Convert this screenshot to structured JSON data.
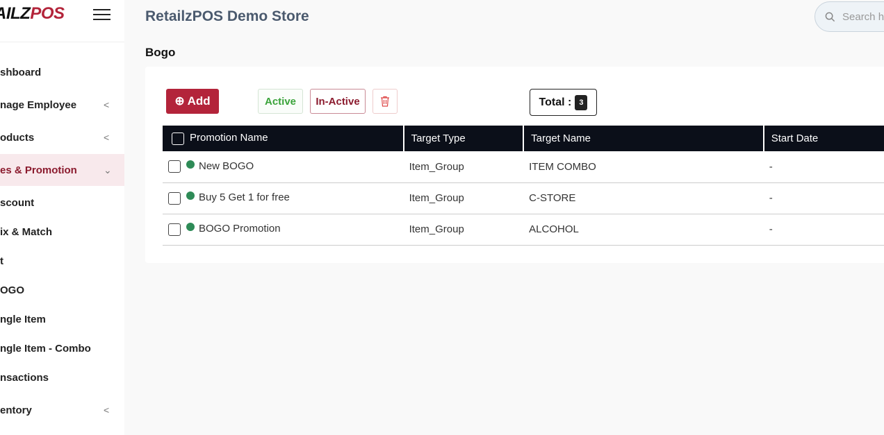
{
  "logo": {
    "part1": "AILZ",
    "part2": "POS"
  },
  "sidebar": {
    "items": [
      {
        "label": "shboard",
        "chevron": ""
      },
      {
        "label": "nage Employee",
        "chevron": "<"
      },
      {
        "label": "oducts",
        "chevron": "<"
      },
      {
        "label": "es & Promotion",
        "chevron": "⌄",
        "active": true
      },
      {
        "label": "scount"
      },
      {
        "label": "ix & Match"
      },
      {
        "label": "t"
      },
      {
        "label": "OGO"
      },
      {
        "label": "ngle Item"
      },
      {
        "label": "ngle Item - Combo"
      },
      {
        "label": "nsactions"
      },
      {
        "label": "entory",
        "chevron": "<"
      }
    ]
  },
  "header": {
    "title": "RetailzPOS Demo Store",
    "search_placeholder": "Search he"
  },
  "page": {
    "title": "Bogo"
  },
  "toolbar": {
    "add": "Add",
    "active": "Active",
    "inactive": "In-Active",
    "total_label": "Total :",
    "total": "3"
  },
  "colors": {
    "brand": "#b3243a",
    "active_dot": "#2e8b57",
    "table_header": "#0b0f19"
  },
  "table": {
    "headers": [
      "Promotion Name",
      "Target Type",
      "Target Name",
      "Start Date"
    ],
    "rows": [
      {
        "name": "New BOGO",
        "type": "Item_Group",
        "target": "ITEM COMBO",
        "start": "-"
      },
      {
        "name": "Buy 5 Get 1 for free",
        "type": "Item_Group",
        "target": "C-STORE",
        "start": "-"
      },
      {
        "name": "BOGO Promotion",
        "type": "Item_Group",
        "target": "ALCOHOL",
        "start": "-"
      }
    ]
  }
}
